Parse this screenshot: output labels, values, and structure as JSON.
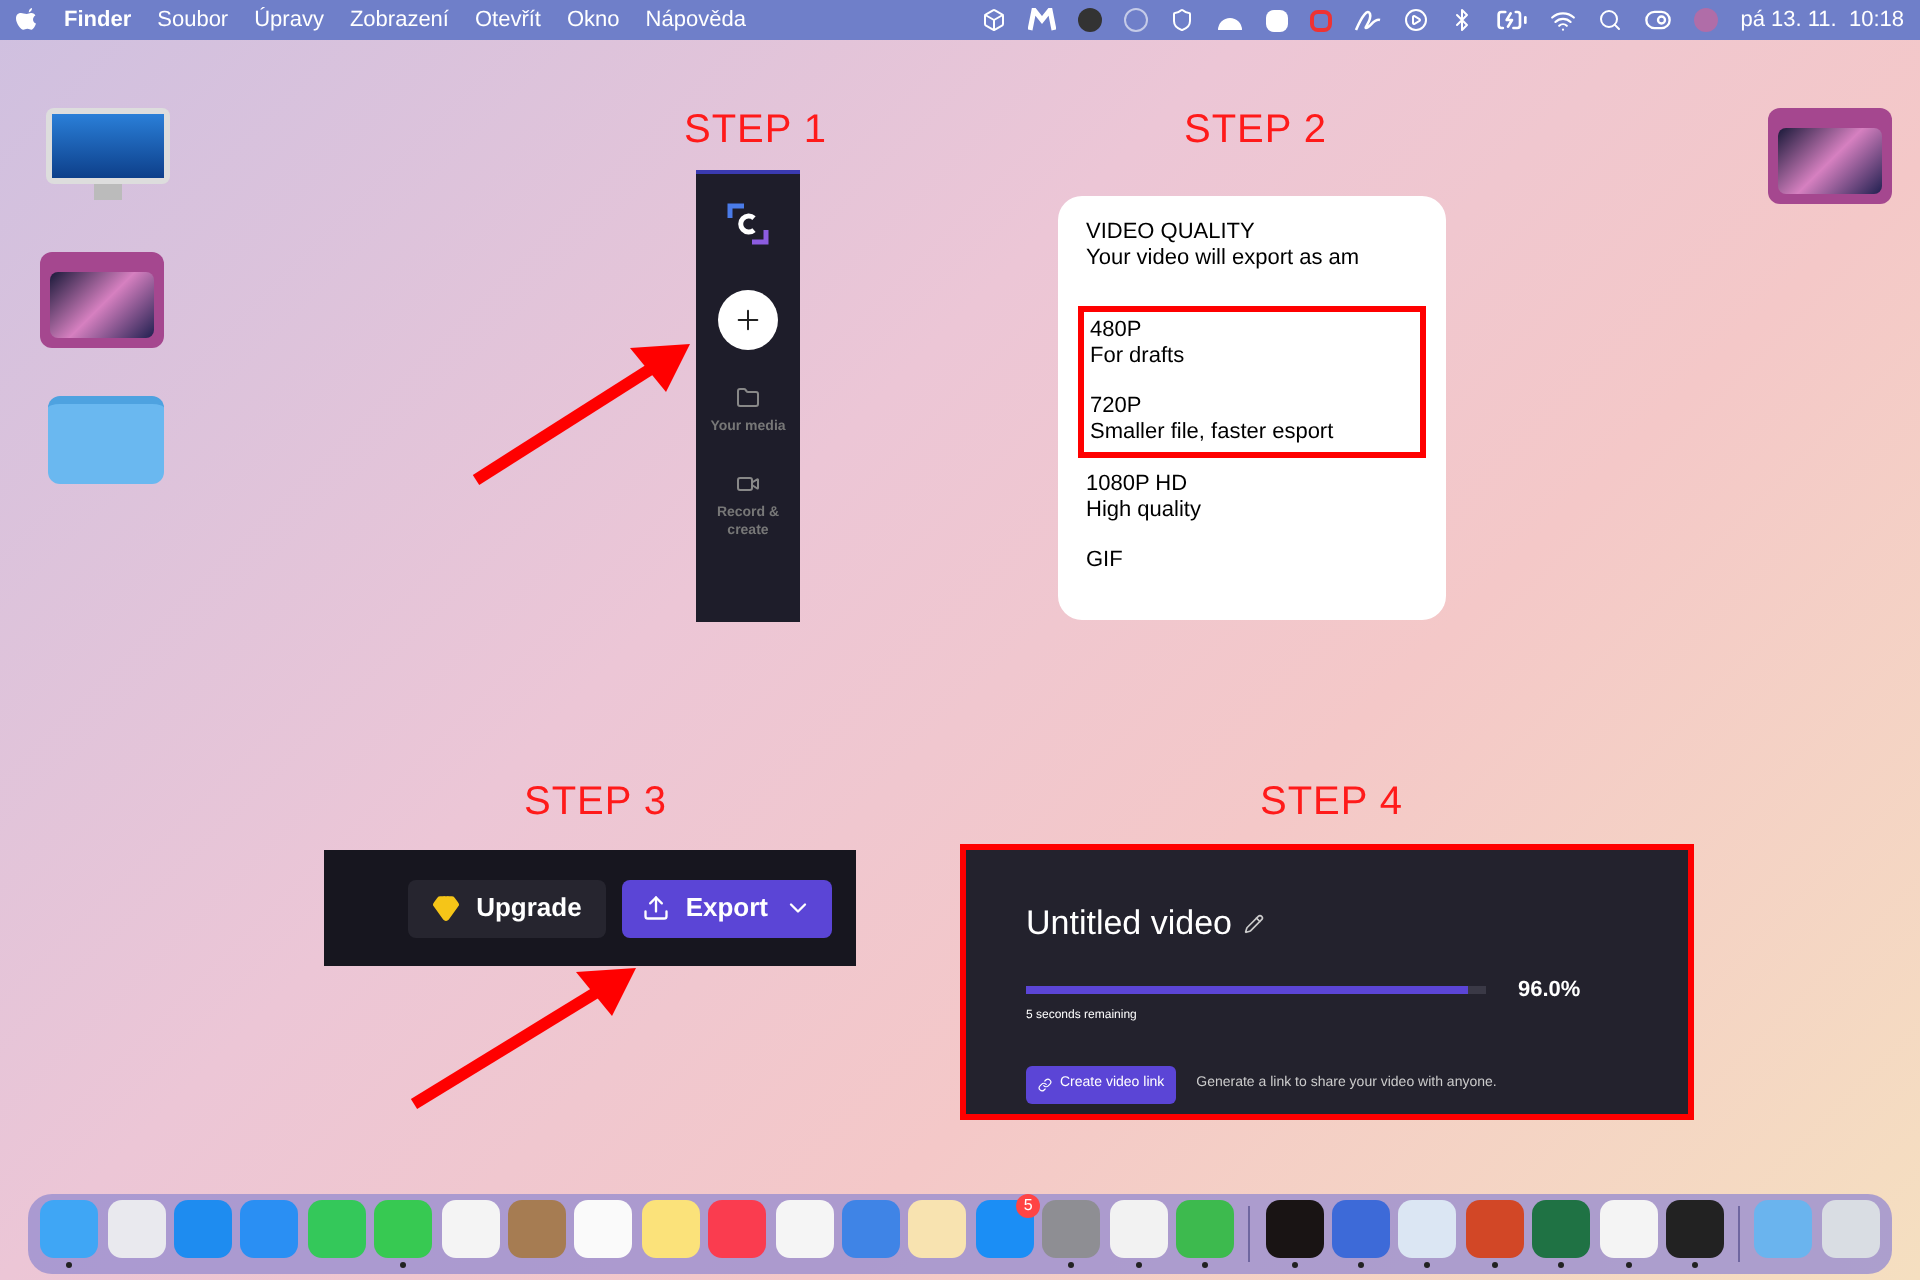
{
  "menu_bar": {
    "menus": [
      {
        "label": "Finder",
        "bold": true
      },
      {
        "label": "Soubor",
        "bold": false
      },
      {
        "label": "Úpravy",
        "bold": false
      },
      {
        "label": "Zobrazení",
        "bold": false
      },
      {
        "label": "Otevřít",
        "bold": false
      },
      {
        "label": "Okno",
        "bold": false
      },
      {
        "label": "Nápověda",
        "bold": false
      }
    ],
    "clock": "pá 13. 11.  10:18"
  },
  "steps": [
    {
      "label": "STEP 1"
    },
    {
      "label": "STEP 2"
    },
    {
      "label": "STEP 3"
    },
    {
      "label": "STEP 4"
    }
  ],
  "step1_sidebar": {
    "items": [
      {
        "label": "Your media"
      },
      {
        "label": "Record & create"
      }
    ]
  },
  "step2_quality": {
    "title": "VIDEO QUALITY",
    "subtitle": "Your video will export as am",
    "options": [
      {
        "name": "480P",
        "description": "For drafts",
        "highlighted": true
      },
      {
        "name": "720P",
        "description": "Smaller file, faster esport",
        "highlighted": true
      },
      {
        "name": "1080P HD",
        "description": "High quality",
        "highlighted": false
      },
      {
        "name": "GIF",
        "highlighted": false
      }
    ]
  },
  "step3_toolbar": {
    "upgrade": "Upgrade",
    "export": "Export"
  },
  "step4_export": {
    "title": "Untitled video",
    "level": 0.96,
    "reading": "96.0%",
    "remaining": "5 seconds remaining",
    "button": "Create video link",
    "hint": "Generate a link to share your video with anyone."
  },
  "dock": {
    "apps": [
      {
        "running": true
      },
      {
        "running": false
      },
      {
        "running": false
      },
      {
        "running": false
      },
      {
        "running": false
      },
      {
        "running": true
      },
      {
        "running": false
      },
      {
        "running": false
      },
      {
        "running": false
      },
      {
        "running": false
      },
      {
        "running": false
      },
      {
        "running": false
      },
      {
        "running": false
      },
      {
        "running": false
      },
      {
        "running": false,
        "badge": "5"
      },
      {
        "running": true
      },
      {
        "running": true
      },
      {
        "running": true
      },
      {
        "running": true
      },
      {
        "running": true
      },
      {
        "running": true
      },
      {
        "running": true
      },
      {
        "running": true
      },
      {
        "running": true
      },
      {
        "running": true
      },
      {
        "running": false
      },
      {
        "running": false
      }
    ]
  }
}
